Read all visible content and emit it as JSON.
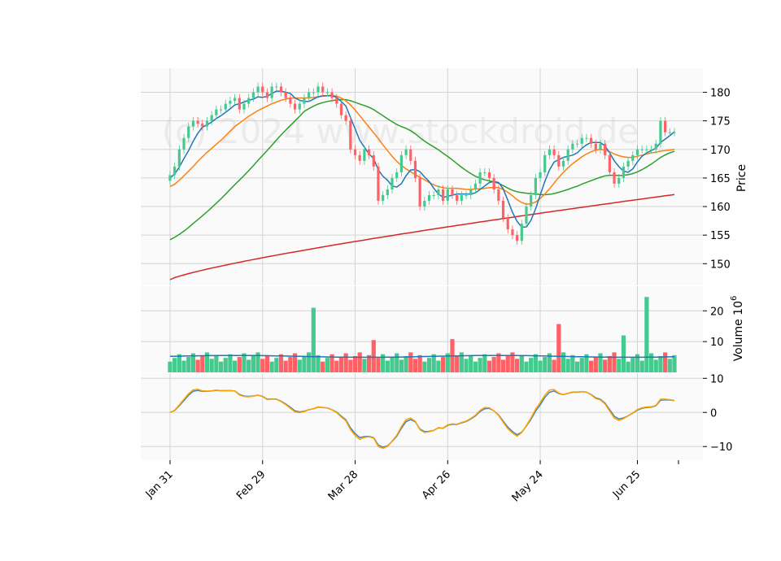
{
  "chart_data": {
    "type": "candlestick",
    "watermark": "(c) 2024 www.stockdroid.de",
    "colors": {
      "up": "#44c98e",
      "down": "#ff6165",
      "ma5": "#1f77b4",
      "ma10": "#ff7f0e",
      "ma30": "#2ca02c",
      "ma100": "#d62728",
      "macd": "#4682b4",
      "signal": "#ffa500",
      "volma": "#1f77b4"
    },
    "x_tick_labels": [
      "Jan 31",
      "Feb 29",
      "Mar 28",
      "Apr 26",
      "May 24",
      "Jun 25"
    ],
    "x_tick_index": [
      0,
      20,
      40,
      60,
      80,
      101
    ],
    "price_panel": {
      "ylabel": "Price",
      "ylim": [
        146.2,
        184.2
      ],
      "yticks": [
        150,
        155,
        160,
        165,
        170,
        175,
        180
      ],
      "candles_close": [
        165.5,
        167,
        170,
        172,
        174,
        175,
        174.5,
        174,
        175,
        176,
        177,
        177,
        178,
        178.5,
        179,
        177,
        178,
        179,
        180,
        181,
        180,
        179,
        181,
        181,
        180,
        179,
        178,
        177,
        178,
        179,
        180,
        180,
        181,
        180,
        180,
        179,
        178,
        176,
        175,
        170,
        169,
        168,
        170,
        169,
        167,
        161,
        162,
        163,
        165,
        166,
        169,
        170,
        168,
        165,
        160,
        161,
        162,
        162,
        163,
        161,
        163,
        162,
        161,
        162,
        162,
        163,
        164,
        166,
        166,
        165,
        163,
        161,
        158,
        156,
        155,
        154,
        157,
        160,
        162,
        165,
        166,
        169,
        170,
        169,
        167,
        168,
        170,
        171,
        171,
        172,
        172,
        171,
        170,
        171,
        169,
        166,
        164,
        165,
        167,
        168,
        169,
        170,
        170,
        170,
        170,
        171,
        175,
        173,
        173,
        173
      ],
      "candles_open": [
        164.5,
        165.5,
        167,
        170,
        172,
        174,
        175,
        174.5,
        174,
        175,
        176,
        177,
        177,
        178,
        178.5,
        179,
        177,
        178,
        179,
        180,
        181,
        180,
        179,
        181,
        181,
        180,
        179,
        178,
        177,
        178,
        179,
        180,
        180,
        181,
        180,
        180,
        179,
        178,
        176,
        175,
        170,
        169,
        168,
        170,
        169,
        167,
        161,
        162,
        163,
        165,
        166,
        169,
        170,
        168,
        165,
        160,
        161,
        162,
        162,
        163,
        161,
        163,
        162,
        161,
        162,
        162,
        163,
        164,
        166,
        166,
        165,
        163,
        161,
        158,
        156,
        155,
        154,
        157,
        160,
        162,
        165,
        166,
        169,
        170,
        169,
        167,
        168,
        170,
        171,
        171,
        172,
        172,
        171,
        170,
        171,
        169,
        166,
        164,
        165,
        167,
        168,
        169,
        170,
        170,
        170,
        170,
        171,
        175,
        173,
        173
      ],
      "ma5": [
        165,
        165.7,
        166.9,
        168.4,
        169.8,
        171.4,
        172.8,
        173.9,
        174.3,
        174.8,
        175.4,
        175.9,
        176.5,
        177.1,
        177.8,
        178,
        178.3,
        178.6,
        178.8,
        179.2,
        179.1,
        179.3,
        179.8,
        180.2,
        180.2,
        180,
        179.8,
        179,
        178.6,
        178.4,
        178.4,
        178.8,
        179.2,
        179.4,
        179.4,
        179.4,
        179.1,
        178.4,
        177.6,
        175.6,
        173.6,
        171.6,
        170.4,
        169.2,
        168.4,
        166.4,
        165.3,
        164.6,
        163.6,
        163.4,
        164,
        165.4,
        166.4,
        166.5,
        166.1,
        165.2,
        164.4,
        163.2,
        162.2,
        161.6,
        161.8,
        162,
        162.2,
        162.2,
        162.2,
        162.2,
        162.4,
        163,
        163.6,
        164.2,
        164.4,
        164.2,
        163.1,
        161.1,
        159,
        157.4,
        156.4,
        156.4,
        157.6,
        159.6,
        162,
        164.4,
        166.4,
        167.8,
        168.2,
        168.6,
        168.8,
        169,
        169.4,
        170.2,
        170.8,
        171.2,
        171.2,
        171.2,
        170.6,
        169.4,
        168,
        167,
        166.2,
        166,
        166.6,
        167.8,
        168.8,
        169.4,
        169.8,
        170.2,
        171.2,
        171.8,
        172.4,
        173.1
      ],
      "ma10": [
        163.5,
        163.9,
        164.6,
        165.4,
        166.2,
        167,
        167.9,
        168.7,
        169.5,
        170.2,
        170.9,
        171.6,
        172.4,
        173.2,
        174,
        174.6,
        175.2,
        175.8,
        176.3,
        176.8,
        177.2,
        177.6,
        178,
        178.3,
        178.6,
        178.8,
        179,
        179,
        179,
        179,
        179,
        179.1,
        179.2,
        179.3,
        179.4,
        179.5,
        179.3,
        179,
        178.5,
        177.8,
        176.9,
        175.9,
        174.9,
        173.9,
        172.9,
        171.9,
        170.8,
        169.8,
        168.8,
        167.9,
        167.2,
        166.6,
        166.1,
        165.6,
        165.1,
        164.7,
        164.2,
        163.8,
        163.5,
        163.3,
        163.2,
        163.2,
        163.2,
        163.1,
        163,
        163,
        163.1,
        163.1,
        163.2,
        163.3,
        163.3,
        163.3,
        163,
        162.5,
        161.9,
        161.2,
        160.7,
        160.4,
        160.5,
        160.8,
        161.4,
        162.2,
        163.1,
        164.1,
        165.1,
        166,
        166.8,
        167.5,
        168.1,
        168.7,
        169.2,
        169.6,
        169.9,
        170,
        169.9,
        169.6,
        169.2,
        168.9,
        168.7,
        168.6,
        168.6,
        168.8,
        169,
        169.2,
        169.4,
        169.5,
        169.7,
        169.8,
        169.9,
        170
      ]
    },
    "volume_panel": {
      "ylabel": "Volume  10^6",
      "ylim": [
        0,
        28
      ],
      "yticks": [
        10,
        20
      ]
    },
    "macd_panel": {
      "ylim": [
        -14,
        11.5
      ],
      "yticks": [
        -10,
        0,
        10
      ]
    }
  }
}
